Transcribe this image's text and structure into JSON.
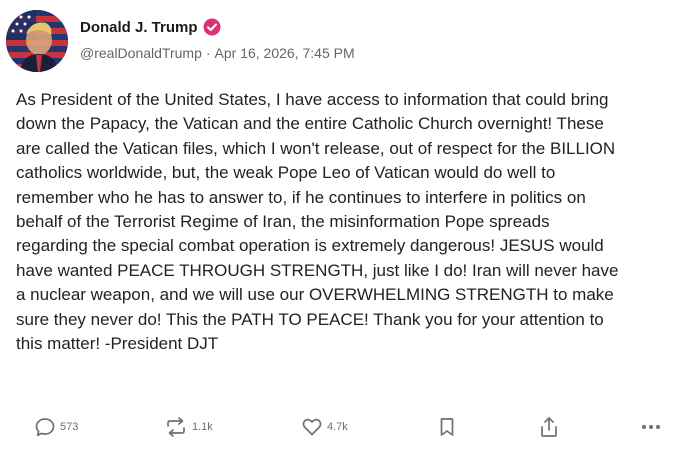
{
  "post": {
    "author": {
      "display_name": "Donald J. Trump",
      "verified": true,
      "handle": "@realDonaldTrump",
      "separator": "·",
      "timestamp": "Apr 16, 2026, 7:45 PM",
      "avatar_icon": "flag-portrait-avatar"
    },
    "body_lines": [
      "As President of the United States, I have access to information that could bring",
      "down the Papacy, the Vatican and the entire Catholic Church overnight! These",
      "are called the Vatican files, which I won't release, out of respect for the BILLION",
      "catholics worldwide, but, the weak Pope Leo of Vatican would do well to",
      "remember who he has to answer to, if he continues to interfere in politics on",
      "behalf of the Terrorist Regime of Iran, the misinformation Pope spreads",
      "regarding the special combat operation is extremely dangerous! JESUS would",
      "have wanted PEACE THROUGH STRENGTH, just like I do! Iran will never have",
      "a nuclear weapon, and we will use our OVERWHELMING STRENGTH to make",
      "sure they never do! This the PATH TO PEACE! Thank you for your attention to",
      "this matter! -President DJT"
    ],
    "actions": {
      "reply": {
        "icon": "reply-icon",
        "count": "573"
      },
      "repost": {
        "icon": "repost-icon",
        "count": "1.1k"
      },
      "like": {
        "icon": "heart-icon",
        "count": "4.7k"
      },
      "bookmark": {
        "icon": "bookmark-icon"
      },
      "share": {
        "icon": "share-icon"
      },
      "more": {
        "icon": "more-icon"
      }
    },
    "colors": {
      "verified_badge": "#d9327a",
      "meta_text": "#606770",
      "icon": "#6b7079"
    }
  }
}
